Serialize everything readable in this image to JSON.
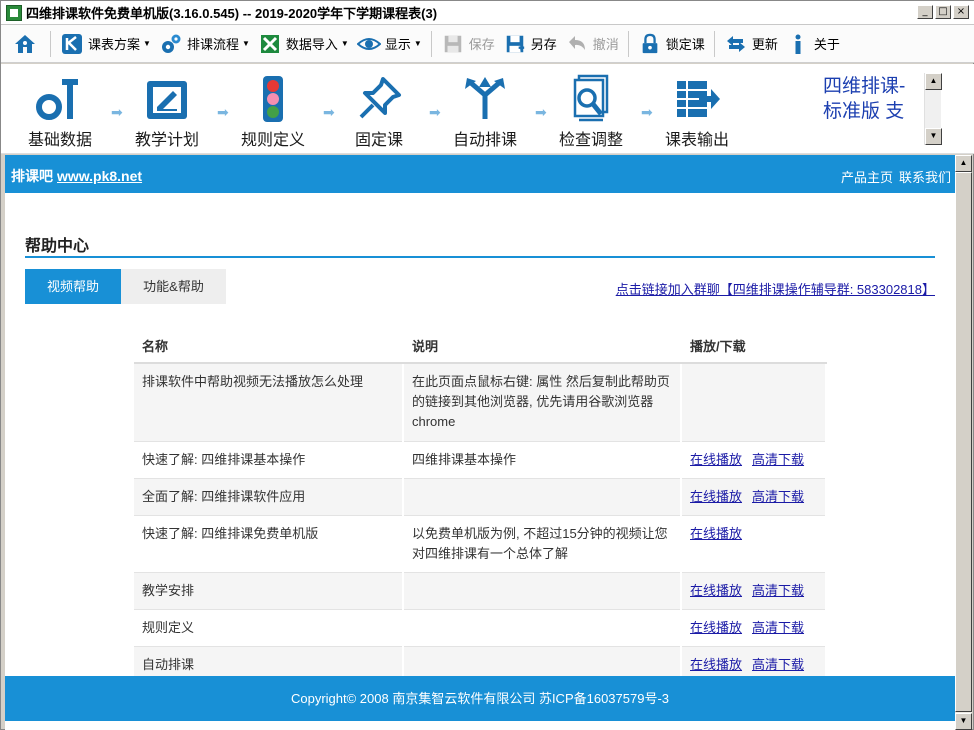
{
  "window": {
    "title": "四维排课软件免费单机版(3.16.0.545) -- 2019-2020学年下学期课程表(3)",
    "controls": [
      "_",
      "□",
      "×"
    ]
  },
  "toolbar": {
    "home_icon": "home-icon",
    "items": [
      {
        "label": "课表方案",
        "icon": "k-logo-icon",
        "dropdown": true,
        "enabled": true
      },
      {
        "label": "排课流程",
        "icon": "gears-icon",
        "dropdown": true,
        "enabled": true
      },
      {
        "label": "数据导入",
        "icon": "excel-icon",
        "dropdown": true,
        "enabled": true
      },
      {
        "label": "显示",
        "icon": "eye-icon",
        "dropdown": true,
        "enabled": true
      },
      {
        "label": "保存",
        "icon": "save-icon",
        "dropdown": false,
        "enabled": false
      },
      {
        "label": "另存",
        "icon": "save-as-icon",
        "dropdown": false,
        "enabled": true
      },
      {
        "label": "撤消",
        "icon": "undo-icon",
        "dropdown": false,
        "enabled": false
      },
      {
        "label": "锁定课",
        "icon": "lock-icon",
        "dropdown": false,
        "enabled": true
      },
      {
        "label": "更新",
        "icon": "refresh-icon",
        "dropdown": false,
        "enabled": true
      },
      {
        "label": "关于",
        "icon": "info-icon",
        "dropdown": false,
        "enabled": true
      }
    ]
  },
  "workflow": {
    "steps": [
      {
        "label": "基础数据",
        "icon": "wrench-bolt-icon"
      },
      {
        "label": "教学计划",
        "icon": "edit-clipboard-icon"
      },
      {
        "label": "规则定义",
        "icon": "traffic-light-icon"
      },
      {
        "label": "固定课",
        "icon": "pushpin-icon"
      },
      {
        "label": "自动排课",
        "icon": "branch-arrows-icon"
      },
      {
        "label": "检查调整",
        "icon": "magnify-document-icon"
      },
      {
        "label": "课表输出",
        "icon": "table-export-icon"
      }
    ],
    "edition_text": "四维排课-标准版 支"
  },
  "site": {
    "brand": "排课吧",
    "url": "www.pk8.net",
    "links": [
      "产品主页",
      "联系我们"
    ],
    "help_title": "帮助中心",
    "tabs": [
      "视频帮助",
      "功能&帮助"
    ],
    "group_link": "点击链接加入群聊【四维排课操作辅导群: 583302818】",
    "table": {
      "headers": [
        "名称",
        "说明",
        "播放/下载"
      ],
      "rows": [
        {
          "name": "排课软件中帮助视频无法播放怎么处理",
          "desc": "在此页面点鼠标右键: 属性 然后复制此帮助页的链接到其他浏览器, 优先请用谷歌浏览器 chrome",
          "play": "",
          "download": ""
        },
        {
          "name": "快速了解: 四维排课基本操作",
          "desc": "四维排课基本操作",
          "play": "在线播放",
          "download": "高清下载"
        },
        {
          "name": "全面了解: 四维排课软件应用",
          "desc": "",
          "play": "在线播放",
          "download": "高清下载"
        },
        {
          "name": "快速了解: 四维排课免费单机版",
          "desc": "以免费单机版为例, 不超过15分钟的视频让您对四维排课有一个总体了解",
          "play": "在线播放",
          "download": ""
        },
        {
          "name": "教学安排",
          "desc": "",
          "play": "在线播放",
          "download": "高清下载"
        },
        {
          "name": "规则定义",
          "desc": "",
          "play": "在线播放",
          "download": "高清下载"
        },
        {
          "name": "自动排课",
          "desc": "",
          "play": "在线播放",
          "download": "高清下载"
        }
      ]
    },
    "footer": "Copyright© 2008 南京集智云软件有限公司 苏ICP备16037579号-3"
  }
}
